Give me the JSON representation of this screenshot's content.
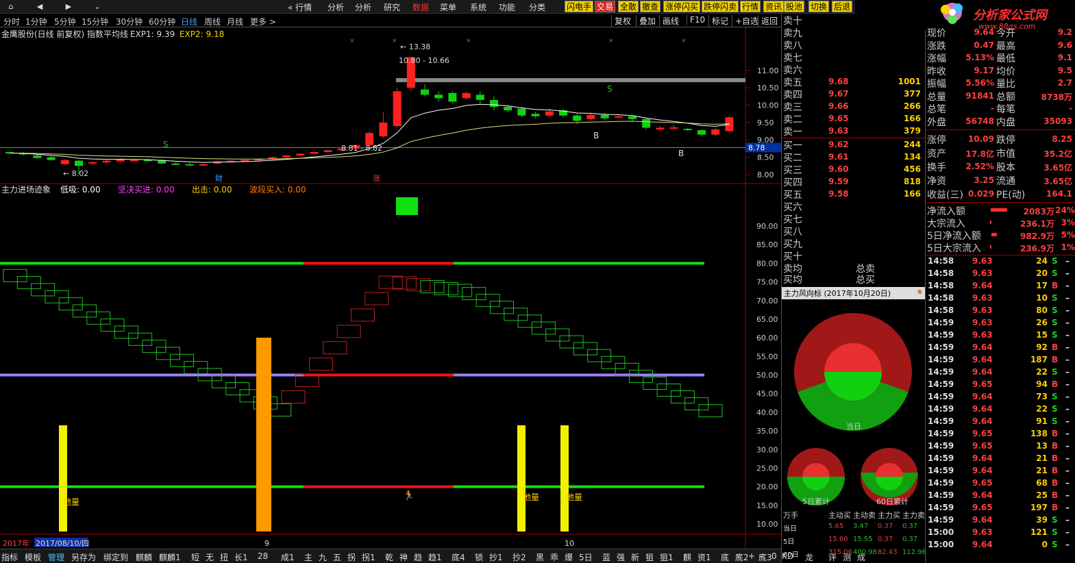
{
  "topnav": {
    "menus": [
      "行情",
      "分析",
      "分析",
      "研究",
      "数据",
      "菜单",
      "系统",
      "功能",
      "分类"
    ],
    "active_menu": "数据",
    "icons": [
      "home-icon",
      "back-icon",
      "forward-icon",
      "dropdown-icon"
    ],
    "highlight_buttons": [
      "闪电手",
      "交易",
      "全散",
      "撤查",
      "涨停闪买",
      "跌停闪卖",
      "行情",
      "资讯",
      "股池",
      "切换",
      "后退"
    ]
  },
  "logo": {
    "text": "分析家公式网",
    "url": "www.88gs.com"
  },
  "periods": [
    "分时",
    "1分钟",
    "5分钟",
    "15分钟",
    "30分钟",
    "60分钟",
    "日线",
    "周线",
    "月线",
    "更多 >"
  ],
  "active_period": "日线",
  "right_tools": [
    "复权",
    "叠加",
    "画线",
    "F10",
    "标记",
    "+自选",
    "返回"
  ],
  "main_chart": {
    "title": "金鹰股份(日线 前复权) 指数平均线",
    "exp1": "EXP1: 9.39",
    "exp2": "EXP2: 9.18",
    "last_price_tag": "8.78",
    "annotations": {
      "high": "13.38",
      "range_top": "10.80 - 10.66",
      "range_mid": "8.81 - 8.82",
      "low": "8.02"
    },
    "markers": {
      "cai": "财",
      "zhang": "涨"
    },
    "y_ticks": [
      "11.00",
      "10.50",
      "10.00",
      "9.50",
      "9.00",
      "8.50",
      "8.00"
    ]
  },
  "chart_data": [
    {
      "type": "candlestick",
      "title": "金鹰股份(日线 前复权) 指数平均线",
      "series": [
        {
          "name": "EXP1",
          "value": "9.39"
        },
        {
          "name": "EXP2",
          "value": "9.18"
        }
      ],
      "ylim": [
        7.9,
        11.5
      ],
      "candles": [
        [
          8.65,
          8.62,
          8.66,
          8.58
        ],
        [
          8.62,
          8.58,
          8.65,
          8.55
        ],
        [
          8.55,
          8.48,
          8.58,
          8.45
        ],
        [
          8.5,
          8.42,
          8.53,
          8.4
        ],
        [
          8.3,
          8.42,
          8.45,
          8.28
        ],
        [
          8.4,
          8.25,
          8.42,
          8.02
        ],
        [
          8.32,
          8.36,
          8.38,
          8.28
        ],
        [
          8.35,
          8.4,
          8.43,
          8.32
        ],
        [
          8.38,
          8.45,
          8.48,
          8.35
        ],
        [
          8.4,
          8.42,
          8.44,
          8.38
        ],
        [
          8.43,
          8.4,
          8.45,
          8.36
        ],
        [
          8.42,
          8.32,
          8.44,
          8.3
        ],
        [
          8.32,
          8.3,
          8.35,
          8.28
        ],
        [
          8.3,
          8.28,
          8.33,
          8.26
        ],
        [
          8.28,
          8.3,
          8.32,
          8.25
        ],
        [
          8.32,
          8.38,
          8.4,
          8.3
        ],
        [
          8.38,
          8.4,
          8.42,
          8.35
        ],
        [
          8.4,
          8.42,
          8.44,
          8.38
        ],
        [
          8.42,
          8.45,
          8.47,
          8.4
        ],
        [
          8.45,
          8.5,
          8.52,
          8.43
        ],
        [
          8.5,
          8.55,
          8.57,
          8.48
        ],
        [
          8.55,
          8.6,
          8.62,
          8.52
        ],
        [
          8.6,
          8.65,
          8.68,
          8.58
        ],
        [
          8.65,
          8.7,
          8.72,
          8.62
        ],
        [
          8.7,
          8.75,
          8.77,
          8.67
        ],
        [
          8.75,
          8.85,
          8.88,
          8.72
        ],
        [
          8.85,
          9.2,
          9.25,
          8.82
        ],
        [
          9.1,
          9.5,
          9.8,
          9.05
        ],
        [
          9.4,
          10.4,
          10.5,
          9.35
        ],
        [
          10.5,
          11.38,
          11.4,
          10.4
        ],
        [
          10.45,
          10.3,
          10.6,
          10.25
        ],
        [
          10.3,
          10.2,
          10.4,
          10.1
        ],
        [
          10.35,
          10.1,
          10.4,
          10.05
        ],
        [
          10.2,
          10.35,
          10.4,
          10.15
        ],
        [
          10.3,
          10.15,
          10.4,
          10.05
        ],
        [
          10.15,
          9.95,
          10.25,
          9.85
        ],
        [
          9.95,
          9.85,
          10.0,
          9.8
        ],
        [
          9.9,
          9.7,
          9.95,
          9.65
        ],
        [
          9.75,
          9.68,
          9.8,
          9.62
        ],
        [
          9.7,
          9.82,
          9.9,
          9.65
        ],
        [
          9.85,
          9.7,
          9.9,
          9.65
        ],
        [
          9.7,
          9.55,
          9.75,
          9.45
        ],
        [
          9.6,
          9.72,
          9.78,
          9.55
        ],
        [
          9.72,
          9.62,
          9.78,
          9.58
        ],
        [
          9.65,
          9.68,
          9.72,
          9.6
        ],
        [
          9.68,
          9.6,
          9.72,
          9.55
        ],
        [
          9.6,
          9.35,
          9.62,
          9.3
        ],
        [
          9.3,
          9.35,
          9.4,
          9.25
        ],
        [
          9.35,
          9.36,
          9.42,
          9.3
        ],
        [
          9.32,
          9.28,
          9.35,
          9.25
        ],
        [
          9.28,
          9.15,
          9.3,
          9.12
        ],
        [
          9.15,
          9.3,
          9.35,
          9.1
        ],
        [
          9.25,
          9.65,
          9.68,
          9.22
        ]
      ]
    },
    {
      "type": "area",
      "title": "主力进场迹象",
      "series": [
        {
          "name": "低吸",
          "value": "0.00"
        },
        {
          "name": "坚决买进",
          "value": "0.00"
        },
        {
          "name": "出击",
          "value": "0.00"
        },
        {
          "name": "波段买入",
          "value": "0.00"
        }
      ],
      "ylim": [
        0,
        100
      ]
    }
  ],
  "sub_chart": {
    "title": "主力进场迹象",
    "fields": [
      {
        "label": "低吸:",
        "value": "0.00",
        "color": "#ffffff"
      },
      {
        "label": "坚决买进:",
        "value": "0.00",
        "color": "#ff40ff"
      },
      {
        "label": "出击:",
        "value": "0.00",
        "color": "#ffd000"
      },
      {
        "label": "波段买入:",
        "value": "0.00",
        "color": "#ff8000"
      }
    ],
    "y_ticks": [
      "90.00",
      "85.00",
      "80.00",
      "75.00",
      "70.00",
      "65.00",
      "60.00",
      "55.00",
      "50.00",
      "45.00",
      "40.00",
      "35.00",
      "30.00",
      "25.00",
      "20.00",
      "15.00",
      "10.00"
    ],
    "labels": {
      "dili": "地量"
    }
  },
  "date_axis": {
    "year": "2017年",
    "selected_date": "2017/08/10/四",
    "month_ticks": [
      "9",
      "10"
    ]
  },
  "orderbook": {
    "sells": [
      {
        "l": "卖十",
        "p": "",
        "v": ""
      },
      {
        "l": "卖九",
        "p": "",
        "v": ""
      },
      {
        "l": "卖八",
        "p": "",
        "v": ""
      },
      {
        "l": "卖七",
        "p": "",
        "v": ""
      },
      {
        "l": "卖六",
        "p": "",
        "v": ""
      },
      {
        "l": "卖五",
        "p": "9.68",
        "v": "1001"
      },
      {
        "l": "卖四",
        "p": "9.67",
        "v": "377"
      },
      {
        "l": "卖三",
        "p": "9.66",
        "v": "266"
      },
      {
        "l": "卖二",
        "p": "9.65",
        "v": "166"
      },
      {
        "l": "卖一",
        "p": "9.63",
        "v": "379"
      }
    ],
    "buys": [
      {
        "l": "买一",
        "p": "9.62",
        "v": "244"
      },
      {
        "l": "买二",
        "p": "9.61",
        "v": "134"
      },
      {
        "l": "买三",
        "p": "9.60",
        "v": "456"
      },
      {
        "l": "买四",
        "p": "9.59",
        "v": "818"
      },
      {
        "l": "买五",
        "p": "9.58",
        "v": "166"
      },
      {
        "l": "买六",
        "p": "",
        "v": ""
      },
      {
        "l": "买七",
        "p": "",
        "v": ""
      },
      {
        "l": "买八",
        "p": "",
        "v": ""
      },
      {
        "l": "买九",
        "p": "",
        "v": ""
      },
      {
        "l": "买十",
        "p": "",
        "v": ""
      }
    ],
    "avg": [
      {
        "l": "卖均",
        "t": "总卖"
      },
      {
        "l": "买均",
        "t": "总买"
      }
    ]
  },
  "stats": [
    {
      "l": "现价",
      "v": "9.64",
      "l2": "今开",
      "v2": "9.2"
    },
    {
      "l": "涨跌",
      "v": "0.47",
      "l2": "最高",
      "v2": "9.6"
    },
    {
      "l": "涨幅",
      "v": "5.13%",
      "l2": "最低",
      "v2": "9.1"
    },
    {
      "l": "昨收",
      "v": "9.17",
      "l2": "均价",
      "v2": "9.5"
    },
    {
      "l": "振幅",
      "v": "5.56%",
      "l2": "量比",
      "v2": "2.7"
    },
    {
      "l": "总量",
      "v": "91841",
      "l2": "总额",
      "v2": "8738万"
    },
    {
      "l": "总笔",
      "v": "-",
      "l2": "每笔",
      "v2": "-"
    },
    {
      "l": "外盘",
      "v": "56748",
      "l2": "内盘",
      "v2": "35093"
    }
  ],
  "stats2": [
    {
      "l": "涨停",
      "v": "10.09",
      "l2": "跌停",
      "v2": "8.25"
    },
    {
      "l": "资产",
      "v": "17.8亿",
      "l2": "市值",
      "v2": "35.2亿"
    },
    {
      "l": "换手",
      "v": "2.52%",
      "l2": "股本",
      "v2": "3.65亿"
    },
    {
      "l": "净资",
      "v": "3.25",
      "l2": "流通",
      "v2": "3.65亿"
    },
    {
      "l": "收益(三)",
      "v": "0.029",
      "l2": "PE(动)",
      "v2": "164.1"
    }
  ],
  "flows": [
    {
      "l": "净流入额",
      "v": "2083万",
      "p": "24%"
    },
    {
      "l": "大宗流入",
      "v": "236.1万",
      "p": "3%"
    },
    {
      "l": "5日净流入额",
      "v": "982.9万",
      "p": "5%"
    },
    {
      "l": "5日大宗流入",
      "v": "236.9万",
      "p": "1%"
    }
  ],
  "ticks": [
    [
      "14:58",
      "9.63",
      "24",
      "S"
    ],
    [
      "14:58",
      "9.63",
      "20",
      "S"
    ],
    [
      "14:58",
      "9.64",
      "17",
      "B"
    ],
    [
      "14:58",
      "9.63",
      "10",
      "S"
    ],
    [
      "14:58",
      "9.63",
      "80",
      "S"
    ],
    [
      "14:59",
      "9.63",
      "26",
      "S"
    ],
    [
      "14:59",
      "9.63",
      "15",
      "S"
    ],
    [
      "14:59",
      "9.64",
      "92",
      "B"
    ],
    [
      "14:59",
      "9.64",
      "187",
      "B"
    ],
    [
      "14:59",
      "9.64",
      "22",
      "S"
    ],
    [
      "14:59",
      "9.65",
      "94",
      "B"
    ],
    [
      "14:59",
      "9.64",
      "73",
      "S"
    ],
    [
      "14:59",
      "9.64",
      "22",
      "S"
    ],
    [
      "14:59",
      "9.64",
      "91",
      "S"
    ],
    [
      "14:59",
      "9.65",
      "138",
      "B"
    ],
    [
      "14:59",
      "9.65",
      "13",
      "B"
    ],
    [
      "14:59",
      "9.64",
      "21",
      "B"
    ],
    [
      "14:59",
      "9.64",
      "21",
      "B"
    ],
    [
      "14:59",
      "9.65",
      "68",
      "B"
    ],
    [
      "14:59",
      "9.64",
      "25",
      "B"
    ],
    [
      "14:59",
      "9.65",
      "197",
      "B"
    ],
    [
      "14:59",
      "9.64",
      "39",
      "S"
    ],
    [
      "15:00",
      "9.63",
      "121",
      "S"
    ],
    [
      "15:00",
      "9.64",
      "0",
      "S"
    ]
  ],
  "wind": {
    "title": "主力风向标 (2017年10月20日)",
    "today": "当日",
    "d5": "5日累计",
    "d60": "60日累计"
  },
  "moneytable": {
    "headers": [
      "万手",
      "主动买",
      "主动卖",
      "主力买",
      "主力卖"
    ],
    "rows": [
      [
        "当日",
        "5.65",
        "3.47",
        "0.37",
        "0.37"
      ],
      [
        "5日",
        "15.60",
        "15.55",
        "0.37",
        "0.37"
      ],
      [
        "60日",
        "315.06",
        "400.98",
        "82.43",
        "112.96"
      ]
    ]
  },
  "bottom_tabs": [
    "指标",
    "模板",
    "管理",
    "另存为",
    "绑定到",
    "麒麟",
    "麒麟1",
    "短",
    "无",
    "扭",
    "长1",
    "28",
    "成1",
    "主",
    "九",
    "五",
    "拐",
    "拐1",
    "乾",
    "神",
    "趋",
    "趋1",
    "底4",
    "锁",
    "抄1",
    "抄2",
    "黑",
    "乖",
    "爆",
    "5日",
    "蓝",
    "强",
    "新",
    "狙",
    "狙1",
    "麒",
    "资1",
    "底",
    "底2",
    "底3",
    "KD",
    "龙头",
    "评",
    "测",
    "成"
  ],
  "active_tab": "管理"
}
